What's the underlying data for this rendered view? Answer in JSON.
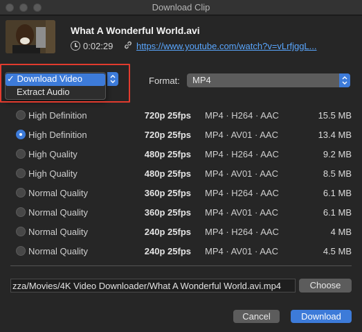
{
  "window": {
    "title": "Download Clip"
  },
  "clip": {
    "title": "What A Wonderful World.avi",
    "duration": "0:02:29",
    "url": "https://www.youtube.com/watch?v=vLrfjggL..."
  },
  "mode_menu": {
    "items": [
      {
        "label": "Download Video",
        "checked": true
      },
      {
        "label": "Extract Audio",
        "checked": false
      }
    ],
    "check_mark": "✓"
  },
  "format": {
    "label": "Format:",
    "value": "MP4"
  },
  "options": [
    {
      "quality": "High Definition",
      "resolution": "720p 25fps",
      "codec": "MP4 · H264 · AAC",
      "size": "15.5 MB",
      "selected": false
    },
    {
      "quality": "High Definition",
      "resolution": "720p 25fps",
      "codec": "MP4 · AV01 · AAC",
      "size": "13.4 MB",
      "selected": true
    },
    {
      "quality": "High Quality",
      "resolution": "480p 25fps",
      "codec": "MP4 · H264 · AAC",
      "size": "9.2 MB",
      "selected": false
    },
    {
      "quality": "High Quality",
      "resolution": "480p 25fps",
      "codec": "MP4 · AV01 · AAC",
      "size": "8.5 MB",
      "selected": false
    },
    {
      "quality": "Normal Quality",
      "resolution": "360p 25fps",
      "codec": "MP4 · H264 · AAC",
      "size": "6.1 MB",
      "selected": false
    },
    {
      "quality": "Normal Quality",
      "resolution": "360p 25fps",
      "codec": "MP4 · AV01 · AAC",
      "size": "6.1 MB",
      "selected": false
    },
    {
      "quality": "Normal Quality",
      "resolution": "240p 25fps",
      "codec": "MP4 · H264 · AAC",
      "size": "4 MB",
      "selected": false
    },
    {
      "quality": "Normal Quality",
      "resolution": "240p 25fps",
      "codec": "MP4 · AV01 · AAC",
      "size": "4.5 MB",
      "selected": false
    }
  ],
  "output": {
    "path": "zza/Movies/4K Video Downloader/What A Wonderful World.avi.mp4",
    "choose_label": "Choose"
  },
  "actions": {
    "cancel_label": "Cancel",
    "download_label": "Download"
  },
  "colors": {
    "accent": "#3d7bd9",
    "highlight_box": "#e23b2e",
    "link": "#5aa7ff"
  }
}
